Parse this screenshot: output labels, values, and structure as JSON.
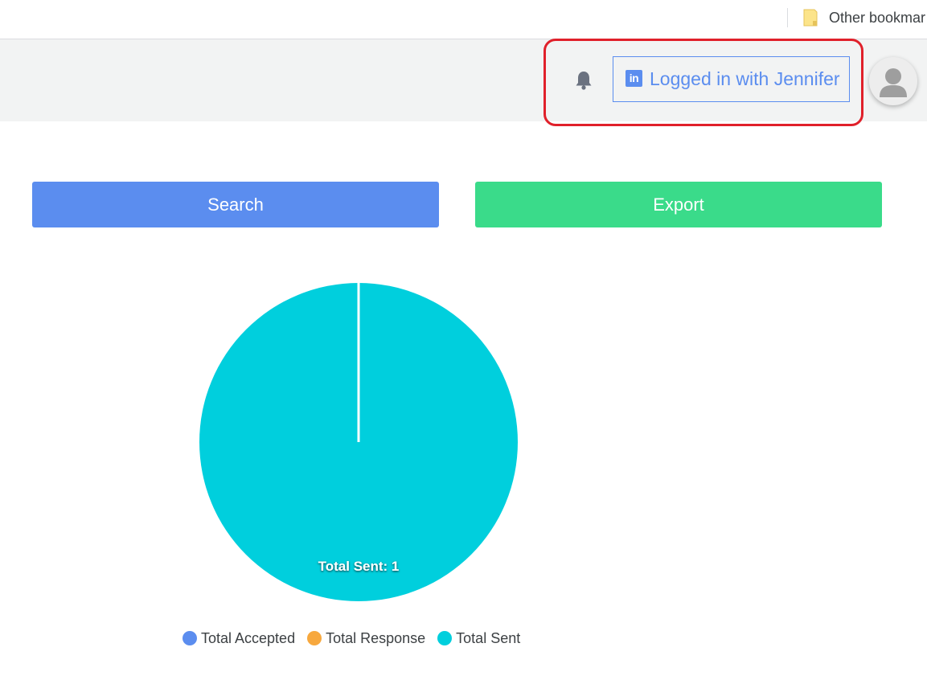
{
  "bookmarks_bar": {
    "other_bookmarks": "Other bookmar"
  },
  "header": {
    "login_status": "Logged in with Jennifer",
    "linkedin_glyph": "in",
    "icons": [
      "bell-icon",
      "linkedin-icon",
      "avatar-icon",
      "folder-icon"
    ]
  },
  "actions": {
    "search_label": "Search",
    "export_label": "Export"
  },
  "colors": {
    "accent_blue": "#5b8def",
    "export_green": "#3adb8a",
    "total_accepted": "#5b8def",
    "total_response": "#f7a83e",
    "total_sent": "#00cfdd",
    "highlight_red": "#e0202a",
    "header_bg": "#f2f3f3"
  },
  "chart_data": {
    "type": "pie",
    "series": [
      {
        "name": "Total Accepted",
        "value": 0,
        "color": "#5b8def"
      },
      {
        "name": "Total Response",
        "value": 0,
        "color": "#f7a83e"
      },
      {
        "name": "Total Sent",
        "value": 1,
        "color": "#00cfdd"
      }
    ],
    "data_labels": [
      "Total Sent: 1"
    ],
    "legend_position": "bottom"
  }
}
